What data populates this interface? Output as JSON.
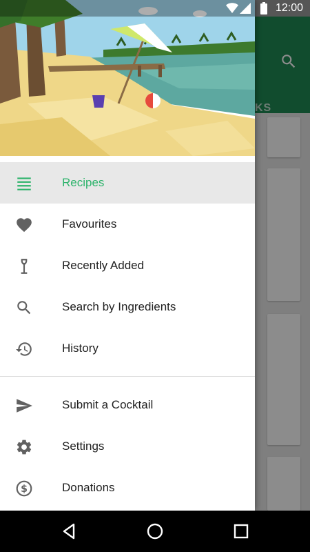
{
  "status_bar": {
    "time": "12:00"
  },
  "app_behind": {
    "tab_label_partial": "KS"
  },
  "drawer": {
    "menu_items": [
      {
        "label": "Recipes",
        "icon": "list-icon",
        "active": true
      },
      {
        "label": "Favourites",
        "icon": "heart-icon"
      },
      {
        "label": "Recently Added",
        "icon": "cocktail-glass-icon"
      },
      {
        "label": "Search by Ingredients",
        "icon": "search-icon"
      },
      {
        "label": "History",
        "icon": "history-icon"
      }
    ],
    "secondary_items": [
      {
        "label": "Submit a Cocktail",
        "icon": "send-icon"
      },
      {
        "label": "Settings",
        "icon": "gear-icon"
      },
      {
        "label": "Donations",
        "icon": "dollar-coin-icon"
      }
    ]
  },
  "colors": {
    "accent": "#2db36b",
    "toolbar": "#1f8a55",
    "icon_gray": "#616161"
  }
}
